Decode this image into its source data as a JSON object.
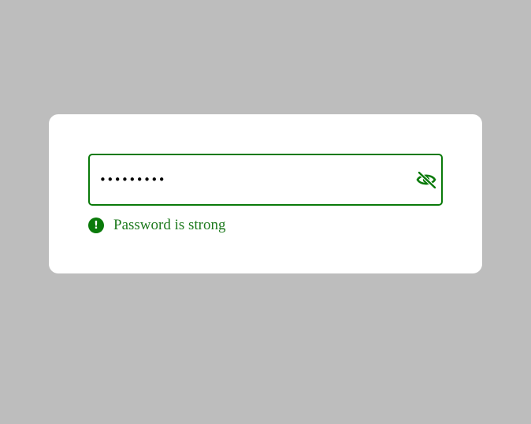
{
  "password_field": {
    "value": "•••••••••",
    "toggle_icon": "eye-slash-icon"
  },
  "validation": {
    "icon": "exclamation-circle-icon",
    "icon_glyph": "!",
    "message": "Password is strong"
  },
  "colors": {
    "background": "#bdbdbd",
    "card": "#ffffff",
    "accent_green": "#0a7a0a",
    "message_green": "#1e7a1e"
  }
}
